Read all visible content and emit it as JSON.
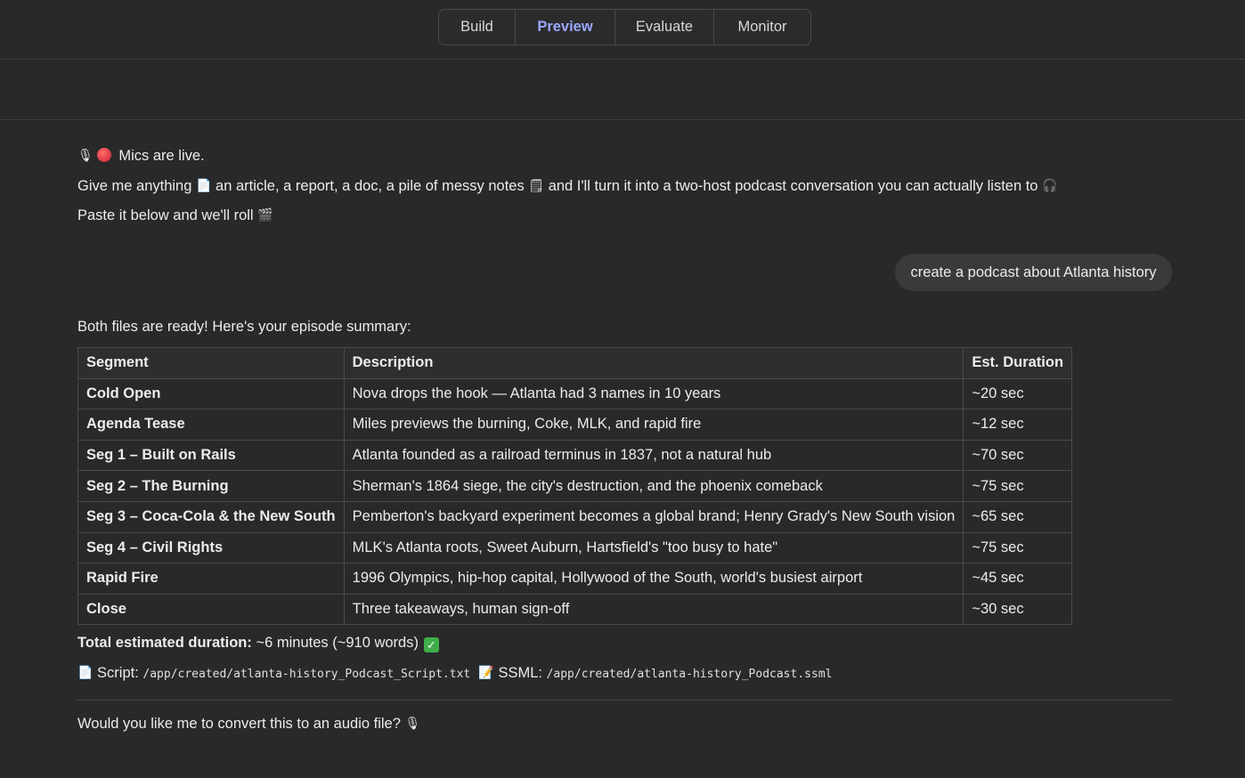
{
  "tabs": [
    {
      "label": "Build",
      "active": false
    },
    {
      "label": "Preview",
      "active": true
    },
    {
      "label": "Evaluate",
      "active": false
    },
    {
      "label": "Monitor",
      "active": false
    }
  ],
  "bot_intro": {
    "line1": "Mics are live.",
    "line2_a": "Give me anything",
    "line2_b": "an article, a report, a doc, a pile of messy notes",
    "line2_c": "and I'll turn it into a two-host podcast conversation you can actually listen to",
    "line3": "Paste it below and we'll roll"
  },
  "user_message": "create a podcast about Atlanta history",
  "response": {
    "intro": "Both files are ready! Here's your episode summary:",
    "table": {
      "headers": [
        "Segment",
        "Description",
        "Est. Duration"
      ],
      "rows": [
        [
          "Cold Open",
          "Nova drops the hook — Atlanta had 3 names in 10 years",
          "~20 sec"
        ],
        [
          "Agenda Tease",
          "Miles previews the burning, Coke, MLK, and rapid fire",
          "~12 sec"
        ],
        [
          "Seg 1 – Built on Rails",
          "Atlanta founded as a railroad terminus in 1837, not a natural hub",
          "~70 sec"
        ],
        [
          "Seg 2 – The Burning",
          "Sherman's 1864 siege, the city's destruction, and the phoenix comeback",
          "~75 sec"
        ],
        [
          "Seg 3 – Coca-Cola & the New South",
          "Pemberton's backyard experiment becomes a global brand; Henry Grady's New South vision",
          "~65 sec"
        ],
        [
          "Seg 4 – Civil Rights",
          "MLK's Atlanta roots, Sweet Auburn, Hartsfield's \"too busy to hate\"",
          "~75 sec"
        ],
        [
          "Rapid Fire",
          "1996 Olympics, hip-hop capital, Hollywood of the South, world's busiest airport",
          "~45 sec"
        ],
        [
          "Close",
          "Three takeaways, human sign-off",
          "~30 sec"
        ]
      ]
    },
    "total_label": "Total estimated duration:",
    "total_value": "~6 minutes (~910 words)",
    "script_label": "Script:",
    "script_path": "/app/created/atlanta-history_Podcast_Script.txt",
    "ssml_label": "SSML:",
    "ssml_path": "/app/created/atlanta-history_Podcast.ssml",
    "question": "Would you like me to convert this to an audio file?"
  },
  "icons": {
    "mic": "microphone-icon",
    "rec": "red-circle-icon",
    "doc": "document-icon",
    "notes": "notepad-icon",
    "headphones": "headphones-icon",
    "clapper": "clapper-board-icon",
    "check": "check-mark-icon"
  },
  "colors": {
    "background": "#292929",
    "active_tab": "#9aa7ff",
    "bubble": "#3a3a3a",
    "check": "#3fae4a"
  }
}
